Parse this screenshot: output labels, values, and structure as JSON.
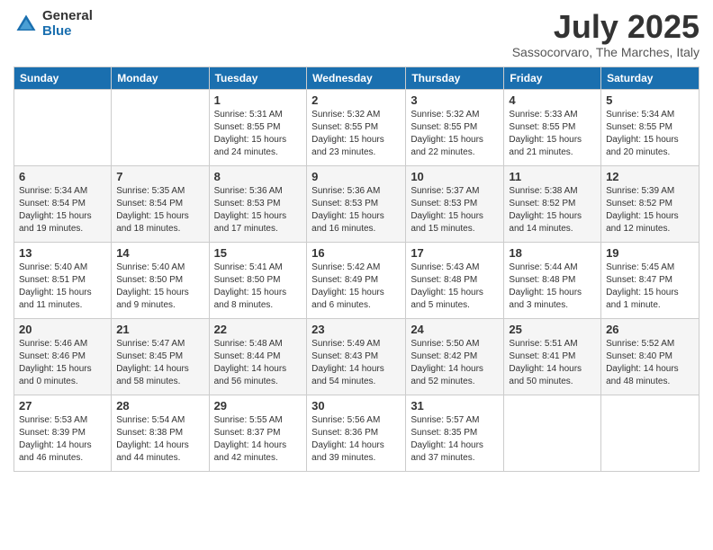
{
  "logo": {
    "general": "General",
    "blue": "Blue"
  },
  "title": "July 2025",
  "subtitle": "Sassocorvaro, The Marches, Italy",
  "headers": [
    "Sunday",
    "Monday",
    "Tuesday",
    "Wednesday",
    "Thursday",
    "Friday",
    "Saturday"
  ],
  "weeks": [
    [
      {
        "day": "",
        "info": ""
      },
      {
        "day": "",
        "info": ""
      },
      {
        "day": "1",
        "info": "Sunrise: 5:31 AM\nSunset: 8:55 PM\nDaylight: 15 hours and 24 minutes."
      },
      {
        "day": "2",
        "info": "Sunrise: 5:32 AM\nSunset: 8:55 PM\nDaylight: 15 hours and 23 minutes."
      },
      {
        "day": "3",
        "info": "Sunrise: 5:32 AM\nSunset: 8:55 PM\nDaylight: 15 hours and 22 minutes."
      },
      {
        "day": "4",
        "info": "Sunrise: 5:33 AM\nSunset: 8:55 PM\nDaylight: 15 hours and 21 minutes."
      },
      {
        "day": "5",
        "info": "Sunrise: 5:34 AM\nSunset: 8:55 PM\nDaylight: 15 hours and 20 minutes."
      }
    ],
    [
      {
        "day": "6",
        "info": "Sunrise: 5:34 AM\nSunset: 8:54 PM\nDaylight: 15 hours and 19 minutes."
      },
      {
        "day": "7",
        "info": "Sunrise: 5:35 AM\nSunset: 8:54 PM\nDaylight: 15 hours and 18 minutes."
      },
      {
        "day": "8",
        "info": "Sunrise: 5:36 AM\nSunset: 8:53 PM\nDaylight: 15 hours and 17 minutes."
      },
      {
        "day": "9",
        "info": "Sunrise: 5:36 AM\nSunset: 8:53 PM\nDaylight: 15 hours and 16 minutes."
      },
      {
        "day": "10",
        "info": "Sunrise: 5:37 AM\nSunset: 8:53 PM\nDaylight: 15 hours and 15 minutes."
      },
      {
        "day": "11",
        "info": "Sunrise: 5:38 AM\nSunset: 8:52 PM\nDaylight: 15 hours and 14 minutes."
      },
      {
        "day": "12",
        "info": "Sunrise: 5:39 AM\nSunset: 8:52 PM\nDaylight: 15 hours and 12 minutes."
      }
    ],
    [
      {
        "day": "13",
        "info": "Sunrise: 5:40 AM\nSunset: 8:51 PM\nDaylight: 15 hours and 11 minutes."
      },
      {
        "day": "14",
        "info": "Sunrise: 5:40 AM\nSunset: 8:50 PM\nDaylight: 15 hours and 9 minutes."
      },
      {
        "day": "15",
        "info": "Sunrise: 5:41 AM\nSunset: 8:50 PM\nDaylight: 15 hours and 8 minutes."
      },
      {
        "day": "16",
        "info": "Sunrise: 5:42 AM\nSunset: 8:49 PM\nDaylight: 15 hours and 6 minutes."
      },
      {
        "day": "17",
        "info": "Sunrise: 5:43 AM\nSunset: 8:48 PM\nDaylight: 15 hours and 5 minutes."
      },
      {
        "day": "18",
        "info": "Sunrise: 5:44 AM\nSunset: 8:48 PM\nDaylight: 15 hours and 3 minutes."
      },
      {
        "day": "19",
        "info": "Sunrise: 5:45 AM\nSunset: 8:47 PM\nDaylight: 15 hours and 1 minute."
      }
    ],
    [
      {
        "day": "20",
        "info": "Sunrise: 5:46 AM\nSunset: 8:46 PM\nDaylight: 15 hours and 0 minutes."
      },
      {
        "day": "21",
        "info": "Sunrise: 5:47 AM\nSunset: 8:45 PM\nDaylight: 14 hours and 58 minutes."
      },
      {
        "day": "22",
        "info": "Sunrise: 5:48 AM\nSunset: 8:44 PM\nDaylight: 14 hours and 56 minutes."
      },
      {
        "day": "23",
        "info": "Sunrise: 5:49 AM\nSunset: 8:43 PM\nDaylight: 14 hours and 54 minutes."
      },
      {
        "day": "24",
        "info": "Sunrise: 5:50 AM\nSunset: 8:42 PM\nDaylight: 14 hours and 52 minutes."
      },
      {
        "day": "25",
        "info": "Sunrise: 5:51 AM\nSunset: 8:41 PM\nDaylight: 14 hours and 50 minutes."
      },
      {
        "day": "26",
        "info": "Sunrise: 5:52 AM\nSunset: 8:40 PM\nDaylight: 14 hours and 48 minutes."
      }
    ],
    [
      {
        "day": "27",
        "info": "Sunrise: 5:53 AM\nSunset: 8:39 PM\nDaylight: 14 hours and 46 minutes."
      },
      {
        "day": "28",
        "info": "Sunrise: 5:54 AM\nSunset: 8:38 PM\nDaylight: 14 hours and 44 minutes."
      },
      {
        "day": "29",
        "info": "Sunrise: 5:55 AM\nSunset: 8:37 PM\nDaylight: 14 hours and 42 minutes."
      },
      {
        "day": "30",
        "info": "Sunrise: 5:56 AM\nSunset: 8:36 PM\nDaylight: 14 hours and 39 minutes."
      },
      {
        "day": "31",
        "info": "Sunrise: 5:57 AM\nSunset: 8:35 PM\nDaylight: 14 hours and 37 minutes."
      },
      {
        "day": "",
        "info": ""
      },
      {
        "day": "",
        "info": ""
      }
    ]
  ]
}
